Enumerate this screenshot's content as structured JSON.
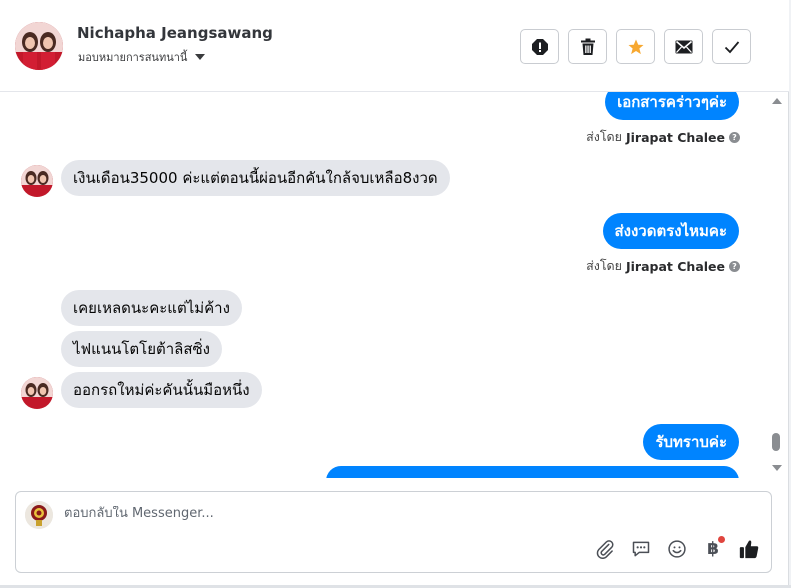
{
  "header": {
    "contact_name": "Nichapha Jeangsawang",
    "assign_label": "มอบหมายการสนทนานี้"
  },
  "actions": [
    {
      "name": "report-icon"
    },
    {
      "name": "trash-icon"
    },
    {
      "name": "star-icon",
      "color": "#f7a830"
    },
    {
      "name": "envelope-icon"
    },
    {
      "name": "check-icon"
    }
  ],
  "messages": [
    {
      "side": "out",
      "text": "เอกสารคร่าวๆค่ะ"
    },
    {
      "side": "meta",
      "prefix": "ส่งโดย",
      "agent": "Jirapat Chalee",
      "icon": "?"
    },
    {
      "side": "in",
      "text": "เงินเดือน35000 ค่ะแต่ตอนนี้ผ่อนอีกคันใกล้จบเหลือ8งวด"
    },
    {
      "side": "out",
      "text": "ส่งงวดตรงไหมคะ"
    },
    {
      "side": "meta",
      "prefix": "ส่งโดย",
      "agent": "Jirapat Chalee",
      "icon": "?"
    },
    {
      "side": "in",
      "text": "เคยเหลดนะคะแต่ไม่ค้าง"
    },
    {
      "side": "in",
      "text": "ไฟแนนโตโยต้าลิสซิ่ง"
    },
    {
      "side": "in",
      "text": "ออกรถใหม่ค่ะคันนั้นมือหนึ่ง"
    },
    {
      "side": "out",
      "text": "รับทราบค่ะ"
    }
  ],
  "composer": {
    "placeholder": "ตอบกลับใน Messenger...",
    "tools": [
      "paperclip-icon",
      "chat-bubble-icon",
      "smiley-icon",
      "baht-icon",
      "thumbs-up-icon"
    ],
    "baht_symbol": "฿",
    "brand_color": "#0084ff"
  }
}
